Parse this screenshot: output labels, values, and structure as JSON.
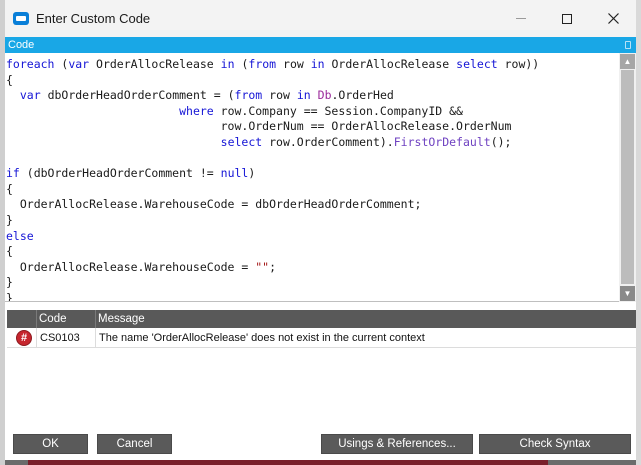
{
  "window": {
    "title": "Enter Custom Code"
  },
  "panel": {
    "header": "Code"
  },
  "editor": {
    "lines": [
      [
        {
          "t": "foreach",
          "c": "kw"
        },
        {
          "t": " ("
        },
        {
          "t": "var",
          "c": "kw"
        },
        {
          "t": " OrderAllocRelease "
        },
        {
          "t": "in",
          "c": "kw"
        },
        {
          "t": " ("
        },
        {
          "t": "from",
          "c": "kw"
        },
        {
          "t": " row "
        },
        {
          "t": "in",
          "c": "kw"
        },
        {
          "t": " OrderAllocRelease "
        },
        {
          "t": "select",
          "c": "kw"
        },
        {
          "t": " row))"
        }
      ],
      [
        {
          "t": "{"
        }
      ],
      [
        {
          "t": "  "
        },
        {
          "t": "var",
          "c": "kw"
        },
        {
          "t": " dbOrderHeadOrderComment = ("
        },
        {
          "t": "from",
          "c": "kw"
        },
        {
          "t": " row "
        },
        {
          "t": "in",
          "c": "kw"
        },
        {
          "t": " "
        },
        {
          "t": "Db",
          "c": "typ"
        },
        {
          "t": ".OrderHed"
        }
      ],
      [
        {
          "t": "                         "
        },
        {
          "t": "where",
          "c": "kw"
        },
        {
          "t": " row.Company == Session.CompanyID &&"
        }
      ],
      [
        {
          "t": "                               row.OrderNum == OrderAllocRelease.OrderNum"
        }
      ],
      [
        {
          "t": "                               "
        },
        {
          "t": "select",
          "c": "kw"
        },
        {
          "t": " row.OrderComment)."
        },
        {
          "t": "FirstOrDefault",
          "c": "mth"
        },
        {
          "t": "();"
        }
      ],
      [],
      [
        {
          "t": "if",
          "c": "kw"
        },
        {
          "t": " (dbOrderHeadOrderComment != "
        },
        {
          "t": "null",
          "c": "kw"
        },
        {
          "t": ")"
        }
      ],
      [
        {
          "t": "{"
        }
      ],
      [
        {
          "t": "  OrderAllocRelease.WarehouseCode = dbOrderHeadOrderComment;"
        }
      ],
      [
        {
          "t": "}"
        }
      ],
      [
        {
          "t": "else",
          "c": "kw"
        }
      ],
      [
        {
          "t": "{"
        }
      ],
      [
        {
          "t": "  OrderAllocRelease.WarehouseCode = "
        },
        {
          "t": "\"\"",
          "c": "str"
        },
        {
          "t": ";"
        }
      ],
      [
        {
          "t": "}"
        }
      ],
      [
        {
          "t": "}"
        }
      ]
    ]
  },
  "errors": {
    "columns": {
      "code": "Code",
      "message": "Message"
    },
    "rows": [
      {
        "icon": "error-icon",
        "icon_glyph": "#",
        "code": "CS0103",
        "message": "The name 'OrderAllocRelease' does not exist in the current context"
      }
    ]
  },
  "buttons": {
    "ok": "OK",
    "cancel": "Cancel",
    "usings": "Usings & References...",
    "check": "Check Syntax"
  },
  "colors": {
    "accent": "#19a7e6",
    "keyword": "#1515d6",
    "error": "#c6262e",
    "button": "#5a5a5a"
  }
}
